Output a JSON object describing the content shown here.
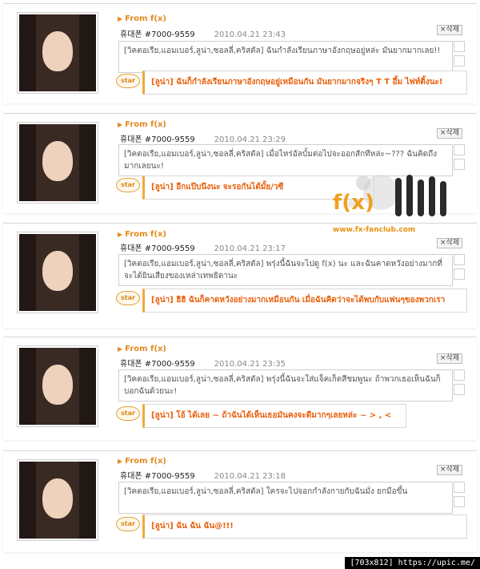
{
  "posts": [
    {
      "from": "From f(x)",
      "name": "휴대폰 #7000-9559",
      "date": "2010.04.21 23:43",
      "delete_label": "삭제",
      "message": "[วิคตอเรีย,แอมเบอร์,ลูน่า,ซอลลี่,คริสตัล] ฉันกำลังเรียนภาษาอังกฤษอยู่หล่ะ มันยากมากเลย!!",
      "star": "star",
      "reply": "[ลูน่า] ฉันก็กำลังเรียนภาษาอังกฤษอยู่เหมือนกัน มันยากมากจริงๆ T T อึ้ม ไฟท์ติ้งนะ!"
    },
    {
      "from": "From f(x)",
      "name": "휴대폰 #7000-9559",
      "date": "2010.04.21 23:29",
      "delete_label": "삭제",
      "message": "[วิคตอเรีย,แอมเบอร์,ลูน่า,ซอลลี่,คริสตัล] เมื่อไหร่อัลบั้มต่อไปจะออกสักทีหล่ะ~??? ฉันคิดถึงมากเลยนะ!",
      "star": "star",
      "reply": "[ลูน่า] อีกแป๊บนึงนะ จะรอกันได้มั้ย/วซี"
    },
    {
      "from": "From f(x)",
      "name": "휴대폰 #7000-9559",
      "date": "2010.04.21 23:17",
      "delete_label": "삭제",
      "message": "[วิคตอเรีย,แอมเบอร์,ลูน่า,ซอลลี่,คริสตัล] พรุ่งนี้ฉันจะไปดู f(x) นะ และฉันคาดหวังอย่างมากที่จะได้ยินเสียงของเหล่าเทพธิดานะ",
      "star": "star",
      "reply": "[ลูน่า] ฮิฮิ ฉันก็คาดหวังอย่างมากเหมือนกัน เมื่อฉันคิดว่าจะได้พบกับแฟนๆของพวกเรา"
    },
    {
      "from": "From f(x)",
      "name": "휴대폰 #7000-9559",
      "date": "2010.04.21 23:35",
      "delete_label": "삭제",
      "message": "[วิคตอเรีย,แอมเบอร์,ลูน่า,ซอลลี่,คริสตัล] พรุ่งนี้ฉันจะใส่แจ็คเก็ตสีชมพูนะ ถ้าพวกเธอเห็นฉันก็บอกฉันด้วยนะ!",
      "star": "star",
      "reply": "[ลูน่า] โอ้ ได้เลย ~ ถ้าฉันได้เห็นเธอมันคงจะดีมากๆเลยหล่ะ ~ > , <"
    },
    {
      "from": "From f(x)",
      "name": "휴대폰 #7000-9559",
      "date": "2010.04.21 23:18",
      "delete_label": "삭제",
      "message": "[วิคตอเรีย,แอมเบอร์,ลูน่า,ซอลลี่,คริสตัล] ใครจะไปจอกกำลังกายกับฉันมั่ง ยกมือขึ้น",
      "star": "star",
      "reply": "[ลูน่า] ฉัน ฉัน ฉัน@!!!"
    }
  ],
  "watermark": {
    "logo": "f(x)",
    "site": "www.fx-fanclub.com"
  },
  "footer": "[703x812] https://upic.me/"
}
